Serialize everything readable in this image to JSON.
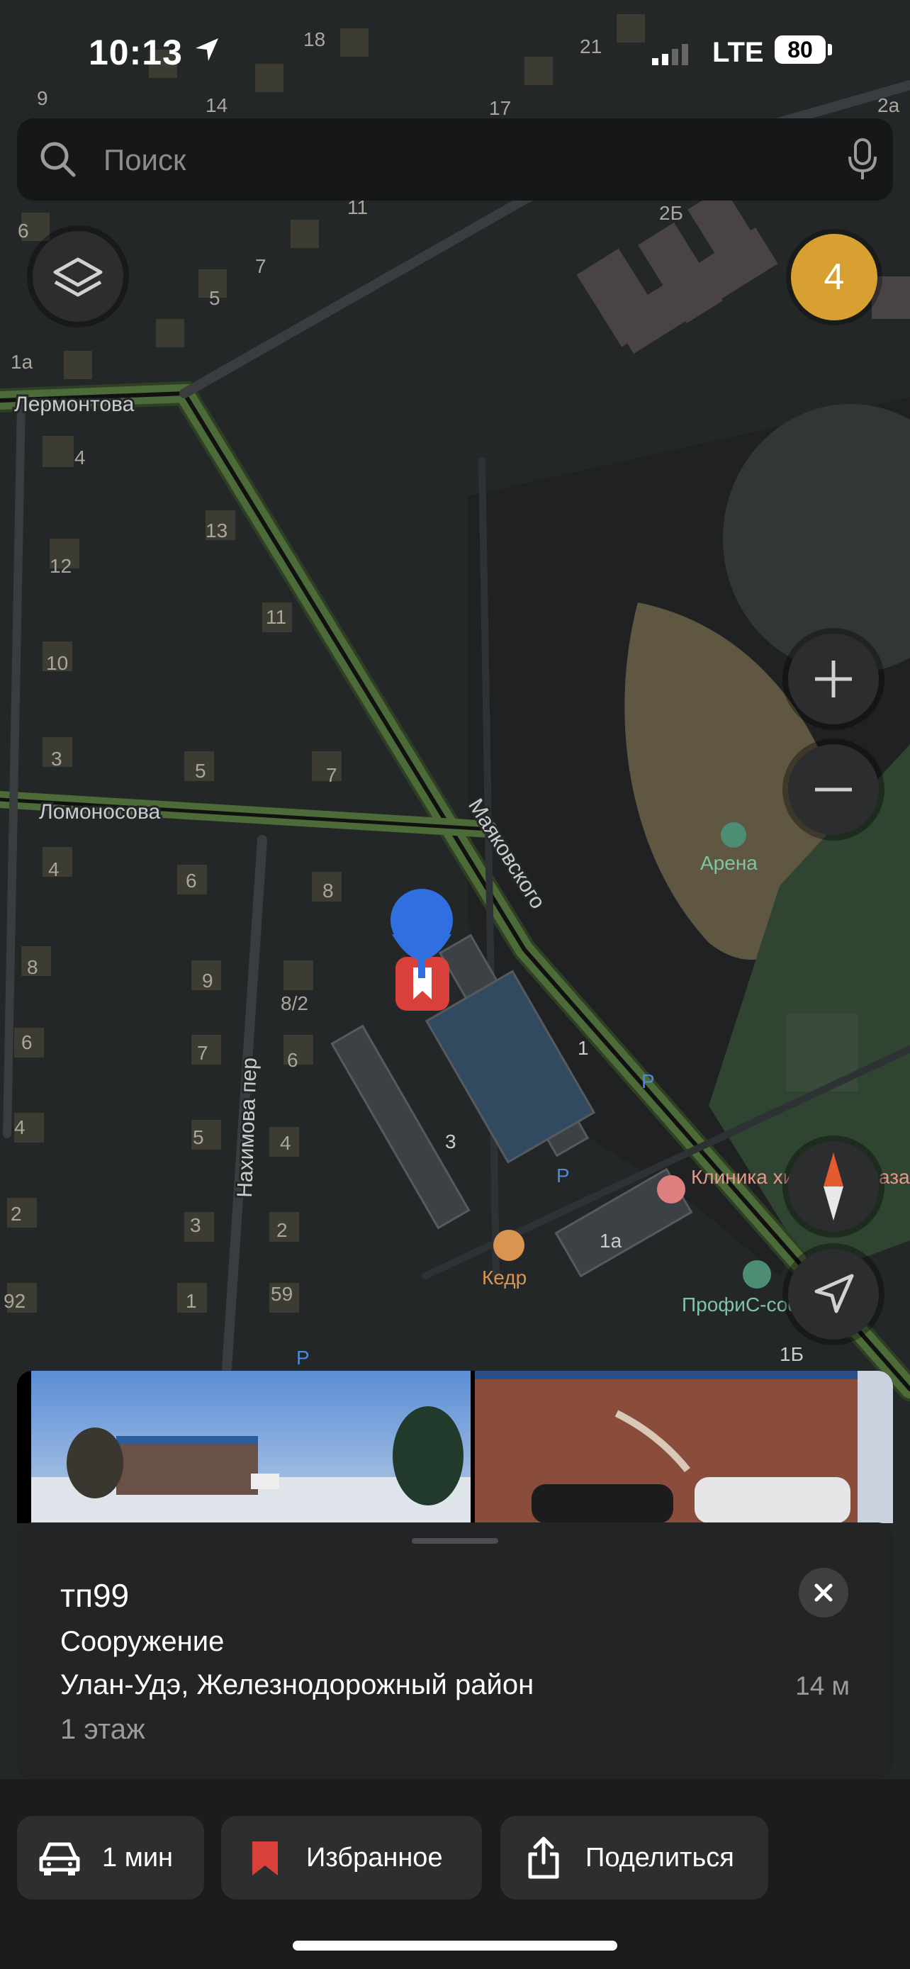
{
  "status_bar": {
    "time": "10:13",
    "network": "LTE",
    "battery": "80"
  },
  "search": {
    "placeholder": "Поиск"
  },
  "badge": {
    "count": "4"
  },
  "map": {
    "street_labels": [
      "Лермонтова",
      "Ломоносова",
      "Маяковского",
      "Нахимова пер"
    ],
    "house_numbers": [
      "9",
      "14",
      "18",
      "21",
      "17",
      "2а",
      "11",
      "2Б",
      "6",
      "7",
      "5",
      "1а",
      "4",
      "13",
      "12",
      "11",
      "10",
      "3",
      "5",
      "7",
      "4",
      "6",
      "8",
      "8",
      "9",
      "8/2",
      "6",
      "7",
      "6",
      "5",
      "4",
      "3",
      "2",
      "59",
      "1",
      "4",
      "2",
      "92",
      "1",
      "3",
      "1а",
      "1Б"
    ],
    "pois": [
      "Арена",
      "Клиника хирургии глаза",
      "Кедр",
      "ПрофиС-софт"
    ]
  },
  "card": {
    "title": "тп99",
    "type": "Сооружение",
    "address": "Улан-Удэ, Железнодорожный район",
    "distance": "14 м",
    "floors": "1 этаж"
  },
  "actions": {
    "route": "1 мин",
    "favorite": "Избранное",
    "share": "Поделиться"
  },
  "colors": {
    "badge": "#d7a030",
    "road_green": "#4d6b38",
    "pin_blue": "#2f6fe0",
    "favorite_red": "#d9403a"
  }
}
